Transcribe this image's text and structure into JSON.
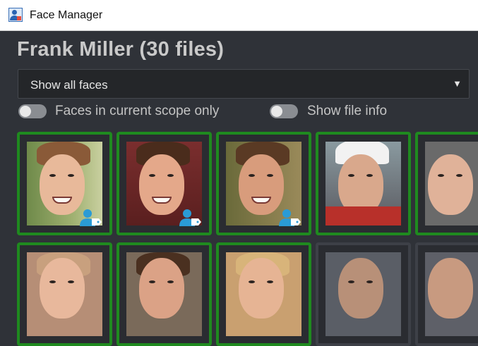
{
  "window": {
    "title": "Face Manager"
  },
  "heading": "Frank Miller (30 files)",
  "filter": {
    "selected": "Show all faces"
  },
  "toggles": [
    {
      "label": "Faces in current scope only",
      "on": false
    },
    {
      "label": "Show file info",
      "on": false
    }
  ],
  "colors": {
    "tile_border_confirmed": "#1f8a1f",
    "tile_border_other": "#3d4047",
    "accent_icon": "#2a9bd6"
  },
  "faces": [
    {
      "row": 1,
      "confirmed": true,
      "icon": "face-tag-icon"
    },
    {
      "row": 1,
      "confirmed": true,
      "icon": "face-tag-icon"
    },
    {
      "row": 1,
      "confirmed": true,
      "icon": "face-tag-icon"
    },
    {
      "row": 1,
      "confirmed": true
    },
    {
      "row": 1,
      "confirmed": true
    },
    {
      "row": 2,
      "confirmed": true
    },
    {
      "row": 2,
      "confirmed": true
    },
    {
      "row": 2,
      "confirmed": true
    },
    {
      "row": 2,
      "confirmed": false
    },
    {
      "row": 2,
      "confirmed": false
    }
  ]
}
